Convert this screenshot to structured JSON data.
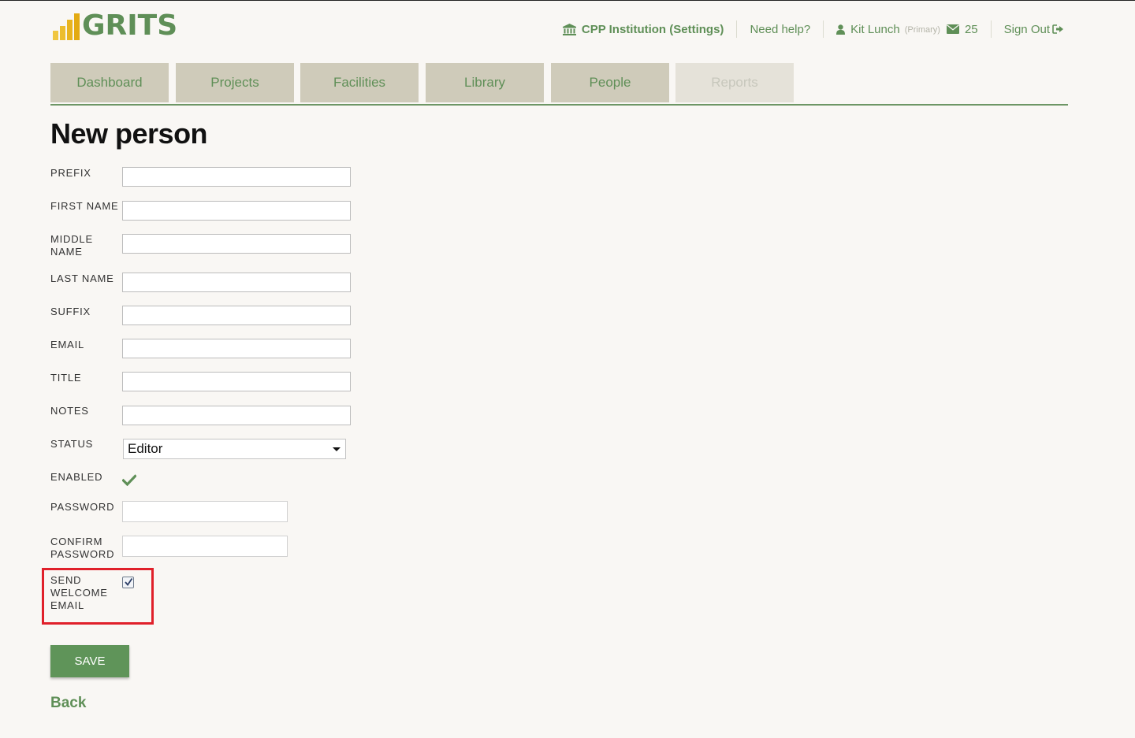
{
  "brand": {
    "name": "GRITS",
    "accent": "#5f8f57",
    "logo_bar_color": "#e8b420"
  },
  "topnav": {
    "institution": "CPP Institution (Settings)",
    "help": "Need help?",
    "user": "Kit Lunch",
    "user_role": "(Primary)",
    "messages_count": "25",
    "sign_out": "Sign Out"
  },
  "tabs": [
    {
      "label": "Dashboard",
      "enabled": true
    },
    {
      "label": "Projects",
      "enabled": true
    },
    {
      "label": "Facilities",
      "enabled": true
    },
    {
      "label": "Library",
      "enabled": true
    },
    {
      "label": "People",
      "enabled": true
    },
    {
      "label": "Reports",
      "enabled": false
    }
  ],
  "page": {
    "title": "New person"
  },
  "form": {
    "prefix": {
      "label": "PREFIX",
      "value": ""
    },
    "first_name": {
      "label": "FIRST NAME",
      "value": ""
    },
    "middle_name": {
      "label": "MIDDLE NAME",
      "value": ""
    },
    "last_name": {
      "label": "LAST NAME",
      "value": ""
    },
    "suffix": {
      "label": "SUFFIX",
      "value": ""
    },
    "email": {
      "label": "EMAIL",
      "value": ""
    },
    "title": {
      "label": "TITLE",
      "value": ""
    },
    "notes": {
      "label": "NOTES",
      "value": ""
    },
    "status": {
      "label": "STATUS",
      "value": "Editor"
    },
    "enabled": {
      "label": "ENABLED",
      "checked": true,
      "icon": "check-icon"
    },
    "password": {
      "label": "PASSWORD",
      "value": ""
    },
    "confirm_password": {
      "label": "CONFIRM PASSWORD",
      "value": ""
    },
    "send_welcome_email": {
      "label": "SEND WELCOME EMAIL",
      "checked": true,
      "highlight_color": "#e0202a"
    }
  },
  "actions": {
    "save": "SAVE",
    "back": "Back"
  }
}
